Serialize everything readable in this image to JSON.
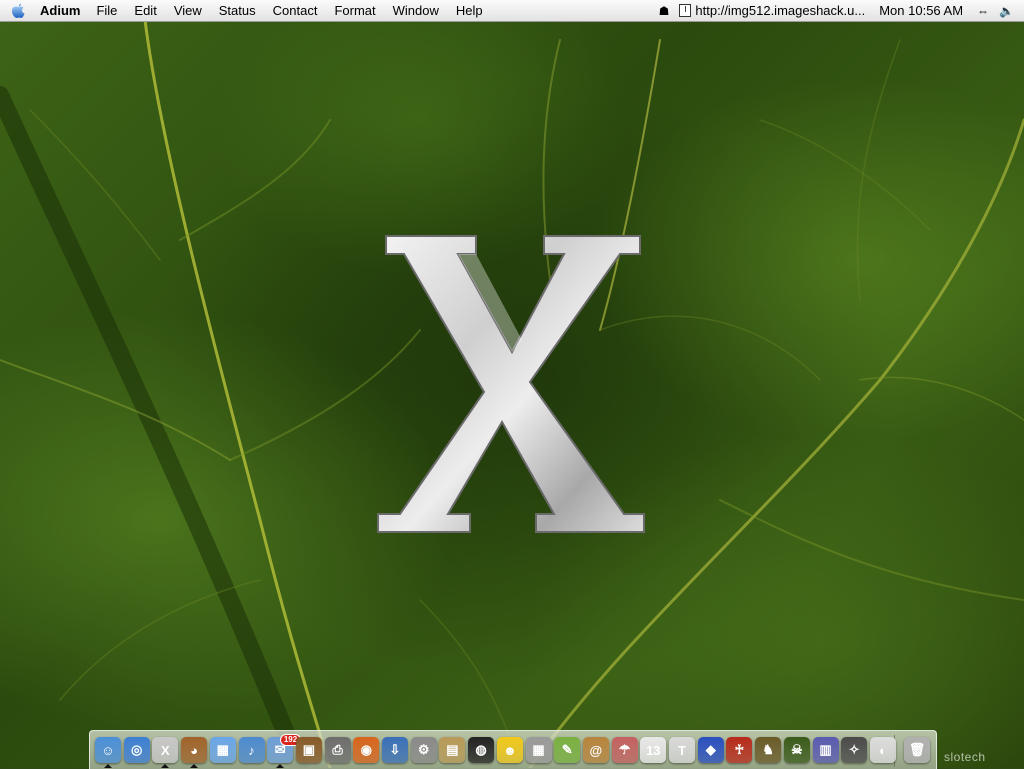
{
  "menubar": {
    "app_name": "Adium",
    "items": [
      "File",
      "Edit",
      "View",
      "Status",
      "Contact",
      "Format",
      "Window",
      "Help"
    ],
    "url_text": "http://img512.imageshack.u...",
    "clock": "Mon 10:56 AM",
    "status_icons": [
      "robot-icon",
      "url-clip-icon",
      "sync-arrows-icon",
      "speaker-icon"
    ]
  },
  "desktop": {
    "logo_letter": "X",
    "watermark": "slotech"
  },
  "dock": {
    "icons": [
      {
        "name": "finder-icon",
        "color": "#4a8fd8",
        "glyph": "☺"
      },
      {
        "name": "safari-icon",
        "color": "#3d7fd4",
        "glyph": "◎"
      },
      {
        "name": "mac-os-x-icon",
        "color": "#c7c7c7",
        "glyph": "X"
      },
      {
        "name": "adium-duck-icon",
        "color": "#a0632a",
        "glyph": "◕"
      },
      {
        "name": "preview-icon",
        "color": "#6aa6e8",
        "glyph": "▦"
      },
      {
        "name": "itunes-icon",
        "color": "#4d8ad0",
        "glyph": "♪"
      },
      {
        "name": "mail-icon",
        "color": "#6d9ed8",
        "glyph": "✉",
        "badge": "192"
      },
      {
        "name": "iphoto-icon",
        "color": "#885a28",
        "glyph": "▣"
      },
      {
        "name": "printer-icon",
        "color": "#6d6d6d",
        "glyph": "⎙"
      },
      {
        "name": "firefox-icon",
        "color": "#d8641c",
        "glyph": "◉"
      },
      {
        "name": "downloads-icon",
        "color": "#3a6fb8",
        "glyph": "⇩"
      },
      {
        "name": "gear-utility-icon",
        "color": "#8a8a8a",
        "glyph": "⚙"
      },
      {
        "name": "stuffit-box-icon",
        "color": "#b89a58",
        "glyph": "▤"
      },
      {
        "name": "black-cat-icon",
        "color": "#222222",
        "glyph": "◍"
      },
      {
        "name": "yellow-face-icon",
        "color": "#f0c81a",
        "glyph": "☻"
      },
      {
        "name": "calculator-icon",
        "color": "#9a9a9a",
        "glyph": "▦"
      },
      {
        "name": "pencil-pad-icon",
        "color": "#7ab040",
        "glyph": "✎"
      },
      {
        "name": "address-book-icon",
        "color": "#b8843c",
        "glyph": "@"
      },
      {
        "name": "satellite-dish-icon",
        "color": "#c46060",
        "glyph": "☂"
      },
      {
        "name": "ical-icon",
        "color": "#e8e8e8",
        "glyph": "13"
      },
      {
        "name": "textedit-icon",
        "color": "#d8d8d8",
        "glyph": "T"
      },
      {
        "name": "blue-app-icon",
        "color": "#2a4fc0",
        "glyph": "◆"
      },
      {
        "name": "red-figure-icon",
        "color": "#b82a1a",
        "glyph": "♰"
      },
      {
        "name": "game-art-icon",
        "color": "#6a5a28",
        "glyph": "♞"
      },
      {
        "name": "orc-game-icon",
        "color": "#3a5a1a",
        "glyph": "☠"
      },
      {
        "name": "photo-stack-icon",
        "color": "#5a5ab0",
        "glyph": "▥"
      },
      {
        "name": "emblem-icon",
        "color": "#4a4a4a",
        "glyph": "✧"
      },
      {
        "name": "pill-icon",
        "color": "#dcdcdc",
        "glyph": "◐"
      },
      {
        "name": "trash-icon",
        "color": "#b0b0b0",
        "glyph": "🗑"
      }
    ],
    "running": [
      "finder-icon",
      "mac-os-x-icon",
      "adium-duck-icon",
      "mail-icon"
    ]
  }
}
